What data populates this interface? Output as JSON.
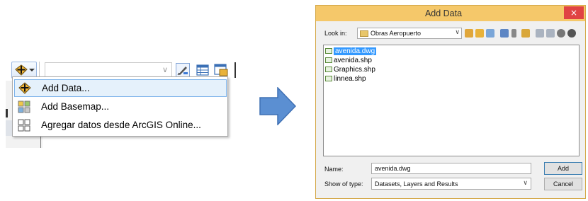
{
  "left_panel": {
    "add_data_tool_icon": "add-data-icon",
    "layer_combo_value": "",
    "menu": [
      {
        "label": "Add Data...",
        "icon": "add-data-icon",
        "selected": true
      },
      {
        "label": "Add Basemap...",
        "icon": "basemap-grid-icon",
        "selected": false
      },
      {
        "label": "Agregar datos desde ArcGIS Online...",
        "icon": "online-grid-icon",
        "selected": false
      }
    ]
  },
  "arrow": {
    "icon": "right-arrow-icon",
    "color": "#5b8fd2"
  },
  "dialog": {
    "title": "Add Data",
    "look_in_label": "Look in:",
    "look_in_value": "Obras Aeropuerto",
    "files": [
      {
        "name": "avenida.dwg",
        "selected": true
      },
      {
        "name": "avenida.shp",
        "selected": false
      },
      {
        "name": "Graphics.shp",
        "selected": false
      },
      {
        "name": "linnea.shp",
        "selected": false
      }
    ],
    "name_label": "Name:",
    "name_value": "avenida.dwg",
    "type_label": "Show of type:",
    "type_value": "Datasets, Layers and Results",
    "add_label": "Add",
    "cancel_label": "Cancel",
    "close_label": "×",
    "titlebar_color": "#f5c86a"
  }
}
